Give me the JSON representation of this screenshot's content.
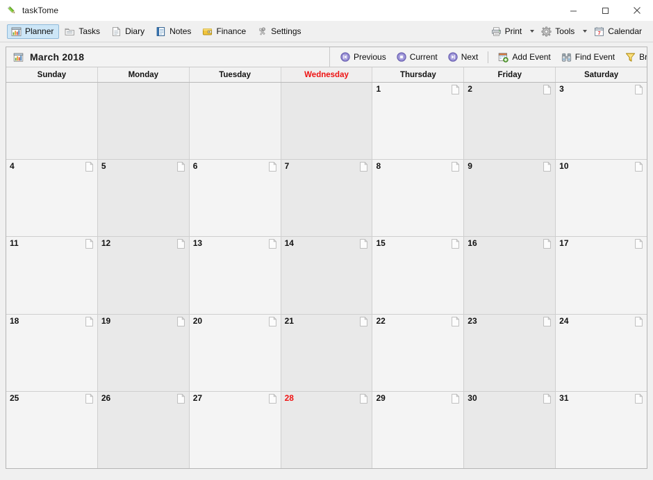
{
  "window": {
    "title": "taskTome",
    "app_icon": "pencil-icon",
    "controls": {
      "minimize": "minimize-icon",
      "maximize": "maximize-icon",
      "close": "close-icon"
    }
  },
  "toolbar": {
    "left_items": [
      {
        "label": "Planner",
        "icon": "planner-icon",
        "selected": true
      },
      {
        "label": "Tasks",
        "icon": "tasks-icon",
        "selected": false
      },
      {
        "label": "Diary",
        "icon": "diary-icon",
        "selected": false
      },
      {
        "label": "Notes",
        "icon": "notes-icon",
        "selected": false
      },
      {
        "label": "Finance",
        "icon": "finance-icon",
        "selected": false
      },
      {
        "label": "Settings",
        "icon": "settings-icon",
        "selected": false
      }
    ],
    "right_items": [
      {
        "label": "Print",
        "icon": "printer-icon",
        "has_caret": true
      },
      {
        "label": "Tools",
        "icon": "gear-icon",
        "has_caret": true
      },
      {
        "label": "Calendar",
        "icon": "calendar-icon",
        "has_caret": false
      }
    ]
  },
  "calendar": {
    "icon": "calendar-small-icon",
    "title": "March 2018",
    "nav": [
      {
        "label": "Previous",
        "icon": "previous-icon"
      },
      {
        "label": "Current",
        "icon": "current-icon"
      },
      {
        "label": "Next",
        "icon": "next-icon"
      }
    ],
    "actions": [
      {
        "label": "Add Event",
        "icon": "add-event-icon"
      },
      {
        "label": "Find Event",
        "icon": "find-event-icon"
      },
      {
        "label": "Browse",
        "icon": "browse-icon"
      }
    ],
    "weekdays": [
      {
        "name": "Sunday",
        "highlight": false
      },
      {
        "name": "Monday",
        "highlight": false
      },
      {
        "name": "Tuesday",
        "highlight": false
      },
      {
        "name": "Wednesday",
        "highlight": true
      },
      {
        "name": "Thursday",
        "highlight": false
      },
      {
        "name": "Friday",
        "highlight": false
      },
      {
        "name": "Saturday",
        "highlight": false
      }
    ],
    "today": 28,
    "weeks": [
      [
        {
          "day": null
        },
        {
          "day": null
        },
        {
          "day": null
        },
        {
          "day": null
        },
        {
          "day": 1
        },
        {
          "day": 2
        },
        {
          "day": 3
        }
      ],
      [
        {
          "day": 4
        },
        {
          "day": 5
        },
        {
          "day": 6
        },
        {
          "day": 7
        },
        {
          "day": 8
        },
        {
          "day": 9
        },
        {
          "day": 10
        }
      ],
      [
        {
          "day": 11
        },
        {
          "day": 12
        },
        {
          "day": 13
        },
        {
          "day": 14
        },
        {
          "day": 15
        },
        {
          "day": 16
        },
        {
          "day": 17
        }
      ],
      [
        {
          "day": 18
        },
        {
          "day": 19
        },
        {
          "day": 20
        },
        {
          "day": 21
        },
        {
          "day": 22
        },
        {
          "day": 23
        },
        {
          "day": 24
        }
      ],
      [
        {
          "day": 25
        },
        {
          "day": 26
        },
        {
          "day": 27
        },
        {
          "day": 28
        },
        {
          "day": 29
        },
        {
          "day": 30
        },
        {
          "day": 31
        }
      ]
    ]
  },
  "colors": {
    "today_red": "#f01313",
    "selected_tab_bg": "#cde6f7",
    "window_bg": "#f0f0f0",
    "cell_bg": "#f4f4f4",
    "cell_alt_bg": "#e9e9e9"
  }
}
